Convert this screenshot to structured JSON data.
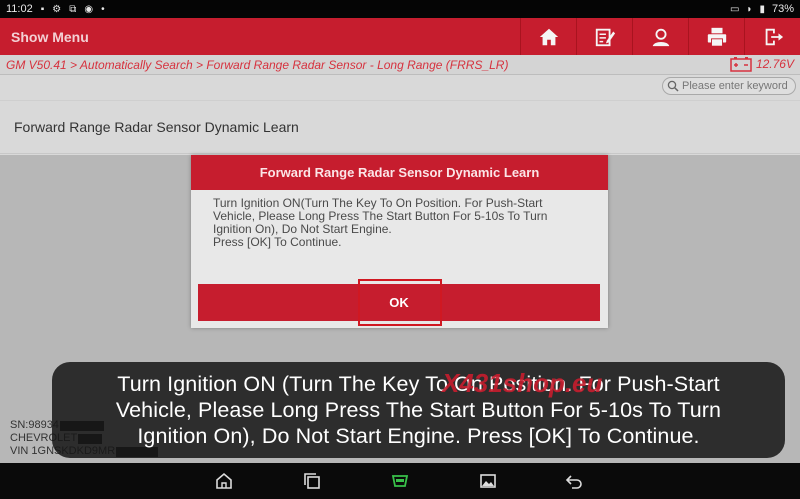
{
  "status_bar": {
    "time": "11:02",
    "battery": "73%"
  },
  "app_bar": {
    "title": "Show Menu",
    "tools": [
      {
        "icon": "home-icon"
      },
      {
        "icon": "edit-report-icon"
      },
      {
        "icon": "user-icon"
      },
      {
        "icon": "print-icon"
      },
      {
        "icon": "exit-icon"
      }
    ]
  },
  "breadcrumb": {
    "text": "GM V50.41 > Automatically Search > Forward Range Radar Sensor - Long Range (FRRS_LR)",
    "voltage": "12.76V"
  },
  "search": {
    "placeholder": "Please enter keyword"
  },
  "list": {
    "items": [
      {
        "label": "Forward Range Radar Sensor Dynamic Learn"
      }
    ]
  },
  "dialog": {
    "title": "Forward Range Radar Sensor Dynamic Learn",
    "body_lines": [
      "Turn Ignition ON(Turn The Key To On Position. For Push-Start",
      "Vehicle, Please Long Press The Start Button For 5-10s To Turn",
      "Ignition On), Do Not Start Engine.",
      "Press [OK] To Continue."
    ],
    "ok_label": "OK"
  },
  "vehicle_info": {
    "sn": "SN:98934",
    "make": "CHEVROLET",
    "vin": "VIN 1GNSKDKD9MR"
  },
  "caption": {
    "lines": [
      "Turn Ignition ON (Turn The Key To On Position. For Push-Start",
      "Vehicle, Please Long Press The Start Button For 5-10s To Turn",
      "Ignition On), Do Not Start Engine. Press [OK] To Continue."
    ]
  },
  "watermark": {
    "text": "X431shop.eu"
  },
  "colors": {
    "brand_red": "#c61d2e",
    "breadcrumb_red": "#d6323e",
    "highlight_red": "#d01822"
  }
}
